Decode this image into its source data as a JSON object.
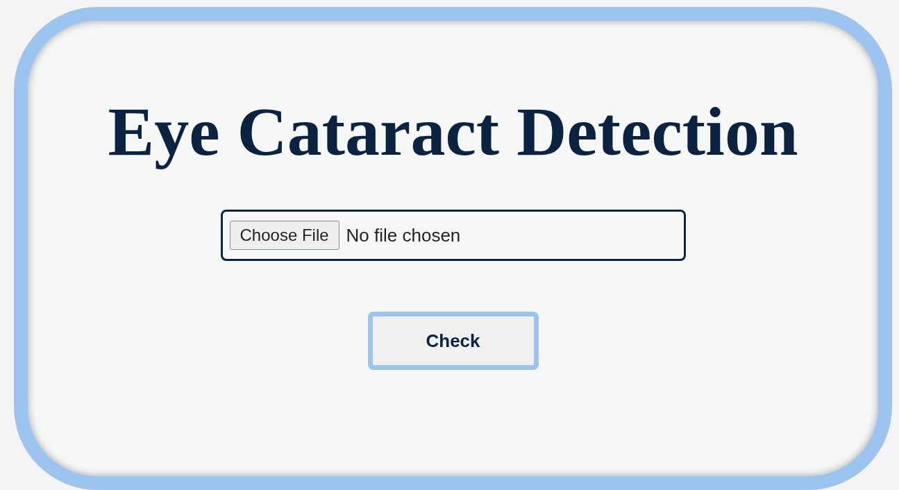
{
  "title": "Eye Cataract Detection",
  "file_input": {
    "button_label": "Choose File",
    "status": "No file chosen"
  },
  "check_button": {
    "label": "Check"
  }
}
